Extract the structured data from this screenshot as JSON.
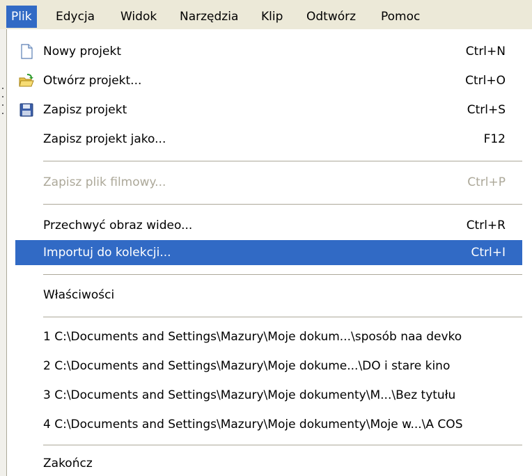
{
  "menubar": {
    "items": [
      {
        "label": "Plik",
        "active": true
      },
      {
        "label": "Edycja"
      },
      {
        "label": "Widok"
      },
      {
        "label": "Narzędzia"
      },
      {
        "label": "Klip"
      },
      {
        "label": "Odtwórz"
      },
      {
        "label": "Pomoc"
      }
    ]
  },
  "file_menu": {
    "new_project": {
      "label": "Nowy projekt",
      "shortcut": "Ctrl+N",
      "icon": "new-document-icon"
    },
    "open_project": {
      "label": "Otwórz projekt...",
      "shortcut": "Ctrl+O",
      "icon": "open-folder-icon"
    },
    "save_project": {
      "label": "Zapisz projekt",
      "shortcut": "Ctrl+S",
      "icon": "save-floppy-icon"
    },
    "save_project_as": {
      "label": "Zapisz projekt jako...",
      "shortcut": "F12"
    },
    "save_movie_file": {
      "label": "Zapisz plik filmowy...",
      "shortcut": "Ctrl+P",
      "disabled": true
    },
    "capture_video": {
      "label": "Przechwyć obraz wideo...",
      "shortcut": "Ctrl+R"
    },
    "import_to_collection": {
      "label": "Importuj do kolekcji...",
      "shortcut": "Ctrl+I",
      "highlighted": true
    },
    "properties": {
      "label": "Właściwości"
    },
    "recent": [
      "1 C:\\Documents and Settings\\Mazury\\Moje dokum...\\sposób naa devko",
      "2 C:\\Documents and Settings\\Mazury\\Moje dokume...\\DO i stare kino",
      "3 C:\\Documents and Settings\\Mazury\\Moje dokumenty\\M...\\Bez tytułu",
      "4 C:\\Documents and Settings\\Mazury\\Moje dokumenty\\Moje w...\\A COS"
    ],
    "exit": {
      "label": "Zakończ"
    }
  },
  "colors": {
    "highlight": "#316ac5",
    "menubar_bg": "#ece9d8",
    "disabled_text": "#aca899",
    "separator": "#aca899"
  }
}
